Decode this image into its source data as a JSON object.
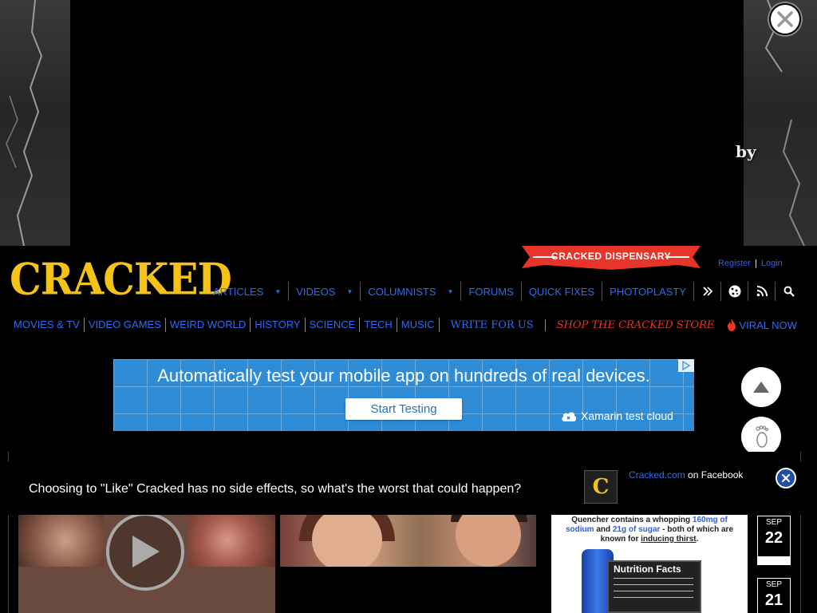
{
  "banner": {
    "by_text": "by"
  },
  "header": {
    "logo": "CRACKED",
    "dispensary_label": "CRACKED DISPENSARY",
    "register": "Register",
    "auth_separator": "|",
    "login": "Login"
  },
  "main_nav": {
    "items": [
      {
        "label": "ARTICLES",
        "has_dropdown": true
      },
      {
        "label": "VIDEOS",
        "has_dropdown": true
      },
      {
        "label": "COLUMNISTS",
        "has_dropdown": true
      },
      {
        "label": "FORUMS",
        "has_dropdown": false
      },
      {
        "label": "QUICK FIXES",
        "has_dropdown": false
      },
      {
        "label": "PHOTOPLASTY",
        "has_dropdown": false
      }
    ],
    "icons": [
      "chevrons-right-icon",
      "cookie-icon",
      "rss-icon",
      "search-icon"
    ]
  },
  "sub_nav": {
    "items": [
      "MOVIES & TV",
      "VIDEO GAMES",
      "WEIRD WORLD",
      "HISTORY",
      "SCIENCE",
      "TECH",
      "MUSIC"
    ],
    "write": "WRITE FOR US",
    "shop": "SHOP THE CRACKED STORE",
    "viral": "VIRAL NOW"
  },
  "ad": {
    "headline": "Automatically test your mobile app on hundreds of real devices.",
    "cta": "Start Testing",
    "brand": "Xamarin test cloud"
  },
  "facebook_bar": {
    "text": "Choosing to \"Like\" Cracked has no side effects, so what's the worst that could happen?",
    "logo_letter": "C",
    "link": "Cracked.com",
    "link_suffix": "on Facebook"
  },
  "sidebar_card": {
    "text_part1": "Quencher contains a whopping",
    "text_hl1": "160mg of sodium",
    "text_part2": "and",
    "text_hl2": "21g of sugar",
    "text_part3": "- both of which are known for",
    "text_hl3": "inducing thirst",
    "text_end": ".",
    "facts_title": "Nutrition Facts"
  },
  "dates": [
    {
      "month": "SEP",
      "day": "22"
    },
    {
      "month": "SEP",
      "day": "21"
    }
  ],
  "colors": {
    "logo": "#f5c21a",
    "link_blue": "#2b6cf0",
    "shop_red": "#e8352a",
    "ad_blue": "#2e8bd6"
  }
}
